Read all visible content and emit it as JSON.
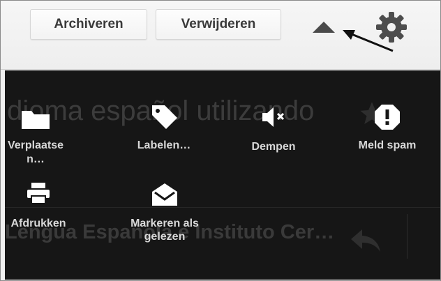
{
  "toolbar": {
    "archive_label": "Archiveren",
    "delete_label": "Verwijderen"
  },
  "background": {
    "subject_snippet": "Idioma español utilizando",
    "title_snippet": "Lengua Española e Instituto Cer…"
  },
  "actions": [
    {
      "label": "Verplaatse n…",
      "icon": "folder-icon"
    },
    {
      "label": "Labelen…",
      "icon": "label-tag-icon"
    },
    {
      "label": "Dempen",
      "icon": "mute-speaker-icon"
    },
    {
      "label": "Meld spam",
      "icon": "report-spam-icon"
    },
    {
      "label": "Afdrukken",
      "icon": "printer-icon"
    },
    {
      "label": "Markeren als gelezen",
      "icon": "open-envelope-icon"
    }
  ],
  "colors": {
    "panel_bg": "#161616",
    "toolbar_bg": "#eeeeee",
    "action_text": "#d8d8d8",
    "icon_white": "#ffffff"
  }
}
